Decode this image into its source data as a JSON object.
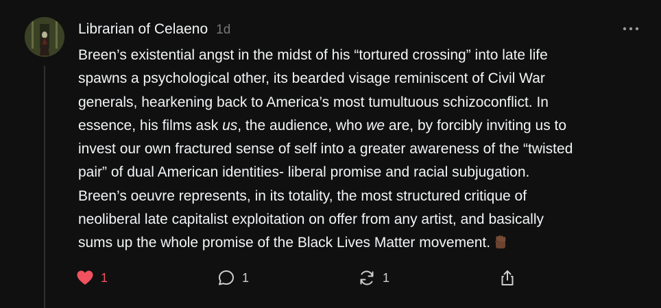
{
  "post": {
    "author": "Librarian of Celaeno",
    "time": "1d",
    "body_lines": [
      [
        "Breen’s existential angst in the midst of his “tortured crossing” into late life"
      ],
      [
        "spawns a psychological other, its bearded visage reminiscent of Civil War"
      ],
      [
        "generals, hearkening back to America’s most tumultuous schizoconflict. In"
      ],
      [
        "essence, his films ask ",
        "us",
        ", the audience, who ",
        "we",
        " are, by forcibly inviting us to"
      ],
      [
        "invest our own fractured sense of self into a greater awareness of the “twisted"
      ],
      [
        "pair” of dual American identities- liberal promise and racial subjugation."
      ],
      [
        "Breen’s oeuvre represents, in its totality, the most structured critique of"
      ],
      [
        "neoliberal late capitalist exploitation on offer from any artist, and basically"
      ],
      [
        "sums up the whole promise of the Black Lives Matter movement."
      ]
    ],
    "emoji": "raised-fist-medium-dark-skin"
  },
  "actions": {
    "likes": "1",
    "replies": "1",
    "reposts": "1"
  },
  "icons": {
    "more": "more-horizontal-icon",
    "like": "heart-filled-icon",
    "reply": "comment-icon",
    "repost": "repost-icon",
    "share": "share-icon"
  },
  "colors": {
    "background": "#101010",
    "like_accent": "#f0525f",
    "muted": "#777777"
  }
}
